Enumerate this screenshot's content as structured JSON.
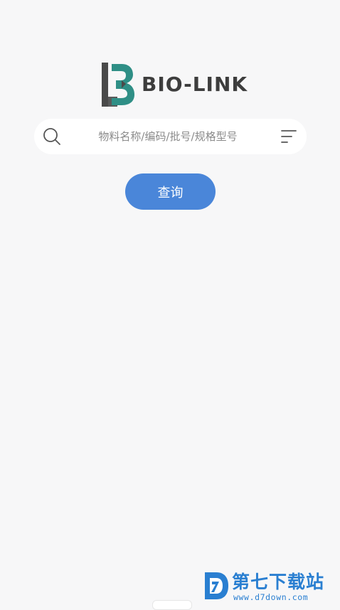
{
  "logo": {
    "text": "BIO-LINK",
    "colors": {
      "dark": "#4a4a4a",
      "teal": "#2f8f86"
    }
  },
  "search": {
    "placeholder": "物料名称/编码/批号/规格型号",
    "value": "",
    "icons": {
      "left": "search-icon",
      "right": "filter-icon"
    }
  },
  "query_button": {
    "label": "查询",
    "color": "#4a86d9"
  },
  "watermark": {
    "title": "第七下载站",
    "url": "www.d7down.com",
    "color": "#2a7fd1"
  }
}
